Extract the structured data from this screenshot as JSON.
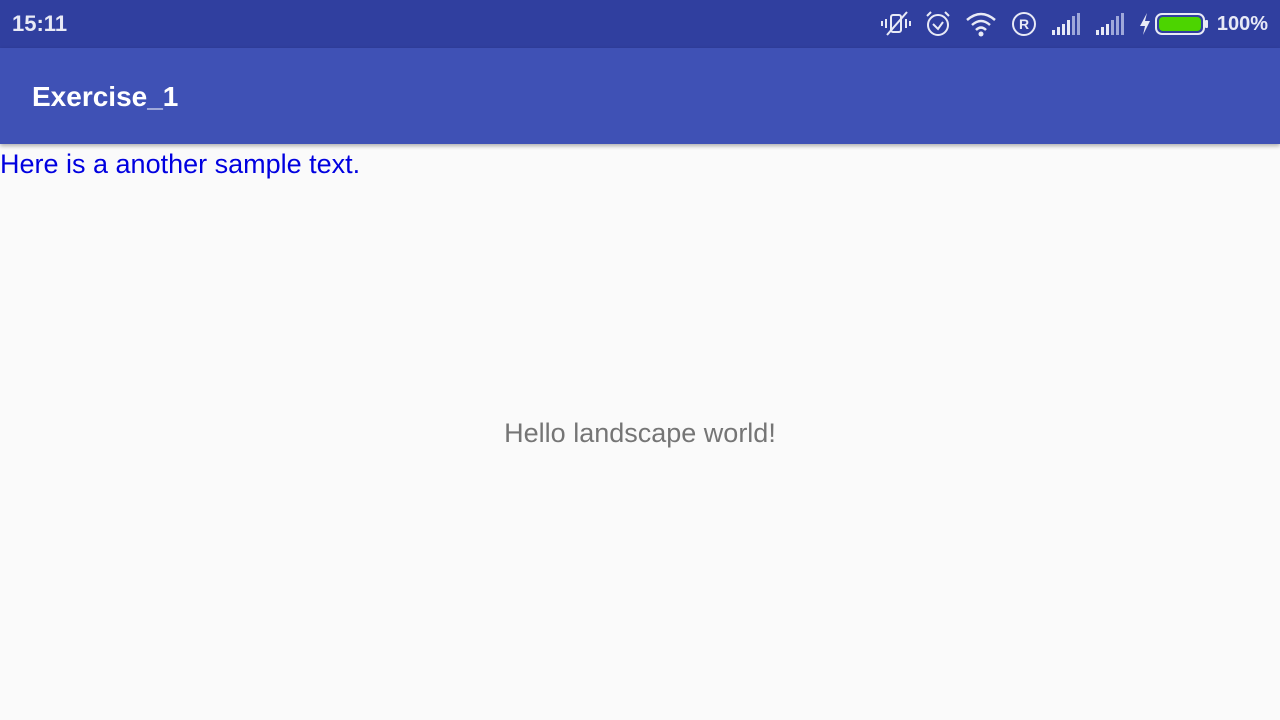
{
  "status_bar": {
    "time": "15:11",
    "icons": [
      "vibrate-off-icon",
      "alarm-icon",
      "wifi-icon",
      "registered-icon",
      "signal-icon",
      "signal-icon",
      "charging-icon",
      "battery-icon"
    ],
    "battery_percent": "100%",
    "battery_level": 1.0,
    "battery_color": "#4cd400"
  },
  "app_bar": {
    "title": "Exercise_1",
    "color": "#3f51b5"
  },
  "content": {
    "sample_text": "Here is a another sample text.",
    "sample_text_color": "#0000e0",
    "center_text": "Hello landscape world!",
    "center_text_color": "#757575"
  }
}
